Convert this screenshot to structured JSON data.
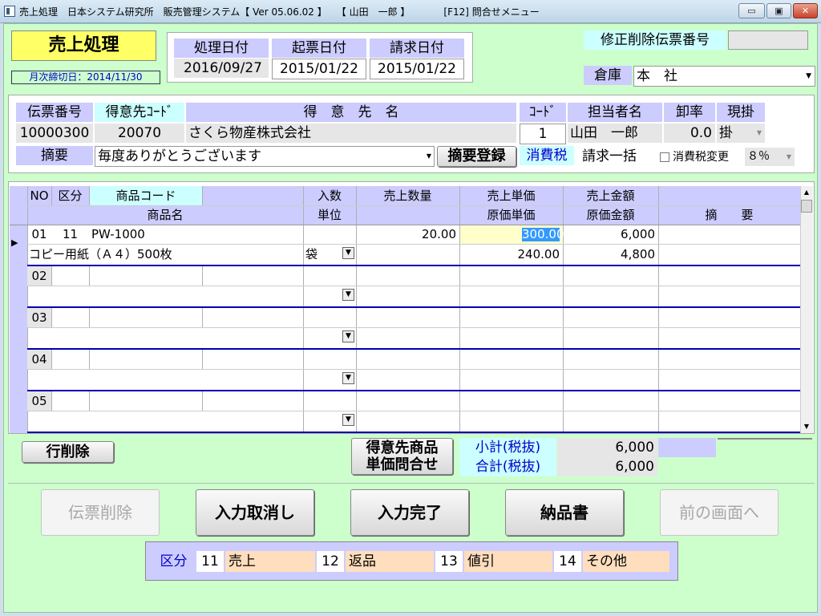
{
  "window": {
    "title": "売上処理　日本システム研究所　販売管理システム【 Ver 05.06.02 】　　【 山田　一郎 】　　　　[F12] 問合せメニュー",
    "min_glyph": "▭",
    "max_glyph": "▣",
    "close_glyph": "✕"
  },
  "header": {
    "screen_title": "売上処理",
    "monthly_close": "月次締切日：2014/11/30",
    "date_labels": [
      "処理日付",
      "起票日付",
      "請求日付"
    ],
    "dates": [
      "2016/09/27",
      "2015/01/22",
      "2015/01/22"
    ],
    "edit_delete_label": "修正削除伝票番号",
    "edit_delete_value": "",
    "warehouse_label": "倉庫",
    "warehouse_value": "本　社"
  },
  "slip": {
    "labels": {
      "slip_no": "伝票番号",
      "customer_code": "得意先ｺｰﾄﾞ",
      "customer_name": "得　意　先　名",
      "code": "ｺｰﾄﾞ",
      "staff": "担当者名",
      "rate": "卸率",
      "cash_credit": "現掛",
      "memo": "摘要",
      "tax": "消費税"
    },
    "slip_no": "10000300",
    "customer_code": "20070",
    "customer_name": "さくら物産株式会社",
    "code": "1",
    "staff": "山田　一郎",
    "rate": "0.0",
    "cash_credit": "掛",
    "memo": "毎度ありがとうございます",
    "memo_register_btn": "摘要登録",
    "tax_mode": "請求一括",
    "tax_change_label": "消費税変更",
    "tax_rate": "８％"
  },
  "grid": {
    "headers_top": {
      "no": "NO",
      "kubun": "区分",
      "code": "商品コード",
      "qty_per": "入数",
      "qty": "売上数量",
      "unit_price": "売上単価",
      "amount": "売上金額"
    },
    "headers_bottom": {
      "name": "商品名",
      "unit": "単位",
      "cost_price": "原価単価",
      "cost_amount": "原価金額",
      "memo": "摘　　要"
    },
    "rows": [
      {
        "no": "01",
        "kubun": "11",
        "code": "PW-1000",
        "qty_per": "",
        "qty": "20.00",
        "unit_price": "300.00",
        "amount": "6,000",
        "memo": "",
        "name": "コピー用紙（Ａ４）500枚",
        "unit": "袋",
        "cost_price": "240.00",
        "cost_amount": "4,800"
      },
      {
        "no": "02",
        "kubun": "",
        "code": "",
        "qty_per": "",
        "qty": "",
        "unit_price": "",
        "amount": "",
        "memo": "",
        "name": "",
        "unit": "",
        "cost_price": "",
        "cost_amount": ""
      },
      {
        "no": "03",
        "kubun": "",
        "code": "",
        "qty_per": "",
        "qty": "",
        "unit_price": "",
        "amount": "",
        "memo": "",
        "name": "",
        "unit": "",
        "cost_price": "",
        "cost_amount": ""
      },
      {
        "no": "04",
        "kubun": "",
        "code": "",
        "qty_per": "",
        "qty": "",
        "unit_price": "",
        "amount": "",
        "memo": "",
        "name": "",
        "unit": "",
        "cost_price": "",
        "cost_amount": ""
      },
      {
        "no": "05",
        "kubun": "",
        "code": "",
        "qty_per": "",
        "qty": "",
        "unit_price": "",
        "amount": "",
        "memo": "",
        "name": "",
        "unit": "",
        "cost_price": "",
        "cost_amount": ""
      }
    ]
  },
  "footer": {
    "delete_row_btn": "行削除",
    "inquiry_btn": "得意先商品\n単価問合せ",
    "subtotal_label": "小計(税抜)",
    "subtotal": "6,000",
    "total_label": "合計(税抜)",
    "total": "6,000",
    "extra_value": ""
  },
  "actions": {
    "delete_slip": "伝票削除",
    "cancel_input": "入力取消し",
    "complete_input": "入力完了",
    "delivery_note": "納品書",
    "prev_screen": "前の画面へ"
  },
  "legend": {
    "label": "区分",
    "items": [
      {
        "code": "11",
        "name": "売上"
      },
      {
        "code": "12",
        "name": "返品"
      },
      {
        "code": "13",
        "name": "値引"
      },
      {
        "code": "14",
        "name": "その他"
      }
    ]
  }
}
